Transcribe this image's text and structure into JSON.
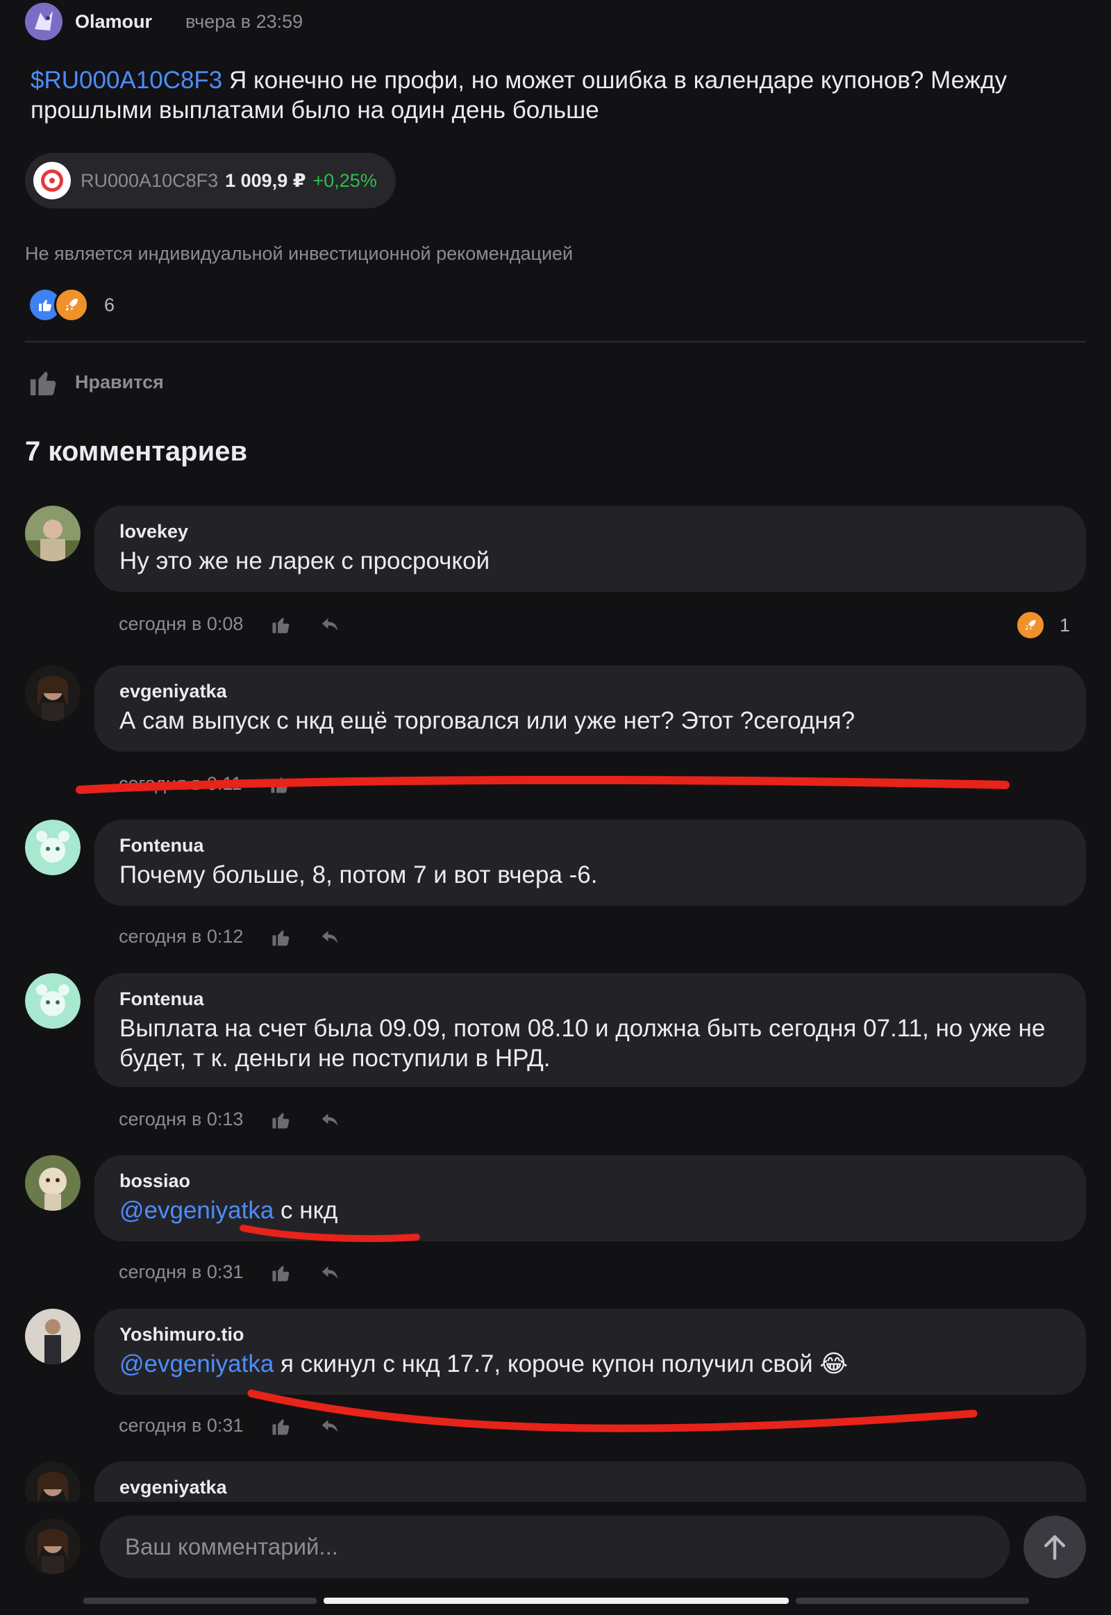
{
  "post": {
    "author": "Olamour",
    "time": "вчера в 23:59",
    "ticker_mention": "$RU000A10C8F3",
    "text": " Я конечно не профи, но может ошибка в календаре купонов? Между прошлыми выплатами было на один день больше",
    "instrument": {
      "ticker": "RU000A10C8F3",
      "price": "1 009,9 ₽",
      "change": "+0,25%"
    },
    "disclaimer": "Не является индивидуальной инвестиционной рекомендацией",
    "reaction_count": "6",
    "like_label": "Нравится"
  },
  "comments_header": "7 комментариев",
  "comments": [
    {
      "author": "lovekey",
      "text": "Ну это же не ларек с просрочкой",
      "time": "сегодня в 0:08",
      "reaction_count": "1"
    },
    {
      "author": "evgeniyatka",
      "text": "А сам выпуск с нкд ещё торговался или уже нет? Этот ?сегодня?",
      "time": "сегодня в 0:11"
    },
    {
      "author": "Fontenua",
      "text": "Почему больше, 8, потом 7 и вот вчера -6.",
      "time": "сегодня в 0:12"
    },
    {
      "author": "Fontenua",
      "text": "Выплата на счет была 09.09, потом 08.10 и должна быть сегодня 07.11, но уже не будет, т к. деньги не поступили в НРД.",
      "time": "сегодня в 0:13"
    },
    {
      "author": "bossiao",
      "mention": "@evgeniyatka",
      "text": " с нкд",
      "time": "сегодня в 0:31"
    },
    {
      "author": "Yoshimuro.tio",
      "mention": "@evgeniyatka",
      "text": " я скинул с нкд 17.7, короче купон получил свой 😂",
      "time": "сегодня в 0:31"
    },
    {
      "author": "evgeniyatka"
    }
  ],
  "input": {
    "placeholder": "Ваш комментарий..."
  },
  "colors": {
    "background": "#121214",
    "bubble": "#232327",
    "link": "#4c8dff",
    "positive": "#2fbf4f",
    "annotation": "#e8231a"
  }
}
